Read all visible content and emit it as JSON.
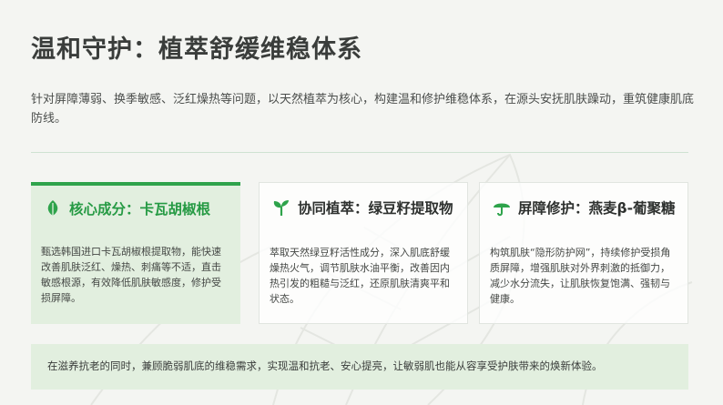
{
  "header": {
    "title": "温和守护：植萃舒缓维稳体系",
    "intro": "针对屏障薄弱、换季敏感、泛红燥热等问题，以天然植萃为核心，构建温和修护维稳体系，在源头安抚肌肤躁动，重筑健康肌底防线。"
  },
  "cards": [
    {
      "icon": "leaf-icon",
      "title": "核心成分：卡瓦胡椒根",
      "body": "甄选韩国进口卡瓦胡椒根提取物，能快速改善肌肤泛红、燥热、刺痛等不适，直击敏感根源，有效降低肌肤敏感度，修护受损屏障。"
    },
    {
      "icon": "sprout-icon",
      "title": "协同植萃：绿豆籽提取物",
      "body": "萃取天然绿豆籽活性成分，深入肌底舒缓燥热火气，调节肌肤水油平衡，改善因内热引发的粗糙与泛红，还原肌肤清爽平和状态。"
    },
    {
      "icon": "umbrella-icon",
      "title": "屏障修护：燕麦β-葡聚糖",
      "body": "构筑肌肤“隐形防护网”，持续修护受损角质屏障，增强肌肤对外界刺激的抵御力，减少水分流失，让肌肤恢复饱满、强韧与健康。"
    }
  ],
  "footer": {
    "text": "在滋养抗老的同时，兼顾脆弱肌底的维稳需求，实现温和抗老、安心提亮，让敏弱肌也能从容享受护肤带来的焕新体验。"
  },
  "colors": {
    "accent": "#2ea34b",
    "active_card_bg": "#e2efdf",
    "page_bg": "#f4f5f2"
  }
}
